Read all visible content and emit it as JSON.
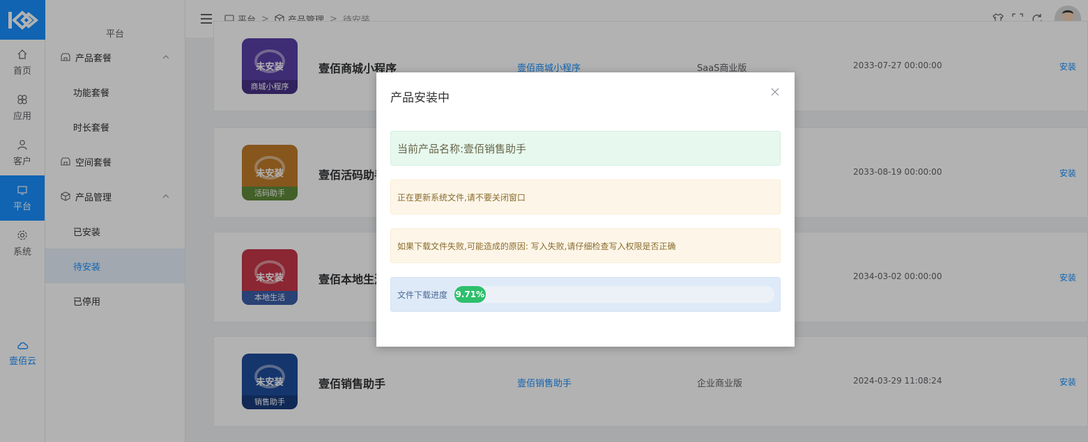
{
  "rail": {
    "items": [
      {
        "label": "首页",
        "icon": "home-icon"
      },
      {
        "label": "应用",
        "icon": "apps-icon"
      },
      {
        "label": "客户",
        "icon": "user-icon"
      },
      {
        "label": "平台",
        "icon": "monitor-icon",
        "active": true
      },
      {
        "label": "系统",
        "icon": "gear-icon"
      }
    ],
    "cloud_label": "壹佰云"
  },
  "submenu": {
    "title": "平台",
    "group1": "产品套餐",
    "item_feature": "功能套餐",
    "item_duration": "时长套餐",
    "group_space": "空间套餐",
    "group2": "产品管理",
    "item_installed": "已安装",
    "item_pending": "待安装",
    "item_disabled": "已停用"
  },
  "breadcrumb": {
    "level1": "平台",
    "level2": "产品管理",
    "level3": "待安装"
  },
  "products": [
    {
      "name": "壹佰商城小程序",
      "link": "壹佰商城小程序",
      "edition": "SaaS商业版",
      "date": "2033-07-27 00:00:00",
      "action": "安装",
      "badge": "未安装",
      "foot": "商城小程序",
      "color": "#5a3fa8"
    },
    {
      "name": "壹佰活码助手",
      "link": "",
      "edition": "",
      "date": "2033-08-19 00:00:00",
      "action": "安装",
      "badge": "未安装",
      "foot": "活码助手",
      "color": "#c07b2a"
    },
    {
      "name": "壹佰本地生活",
      "link": "",
      "edition": "",
      "date": "2034-03-02 00:00:00",
      "action": "安装",
      "badge": "未安装",
      "foot": "本地生活",
      "color": "#c7374a"
    },
    {
      "name": "壹佰销售助手",
      "link": "壹佰销售助手",
      "edition": "企业商业版",
      "date": "2024-03-29 11:08:24",
      "action": "安装",
      "badge": "未安装",
      "foot": "销售助手",
      "color": "#1f4c9c"
    }
  ],
  "dialog": {
    "title": "产品安装中",
    "product_name": "当前产品名称:壹佰销售助手",
    "warning1": "正在更新系统文件,请不要关闭窗口",
    "warning2": "如果下载文件失败,可能造成的原因: 写入失败,请仔细检查写入权限是否正确",
    "progress_label": "文件下载进度",
    "progress_text": "9.71%",
    "progress_fraction": 0.0971
  },
  "colors": {
    "accent": "#1890ff",
    "success": "#2dbf6c"
  }
}
